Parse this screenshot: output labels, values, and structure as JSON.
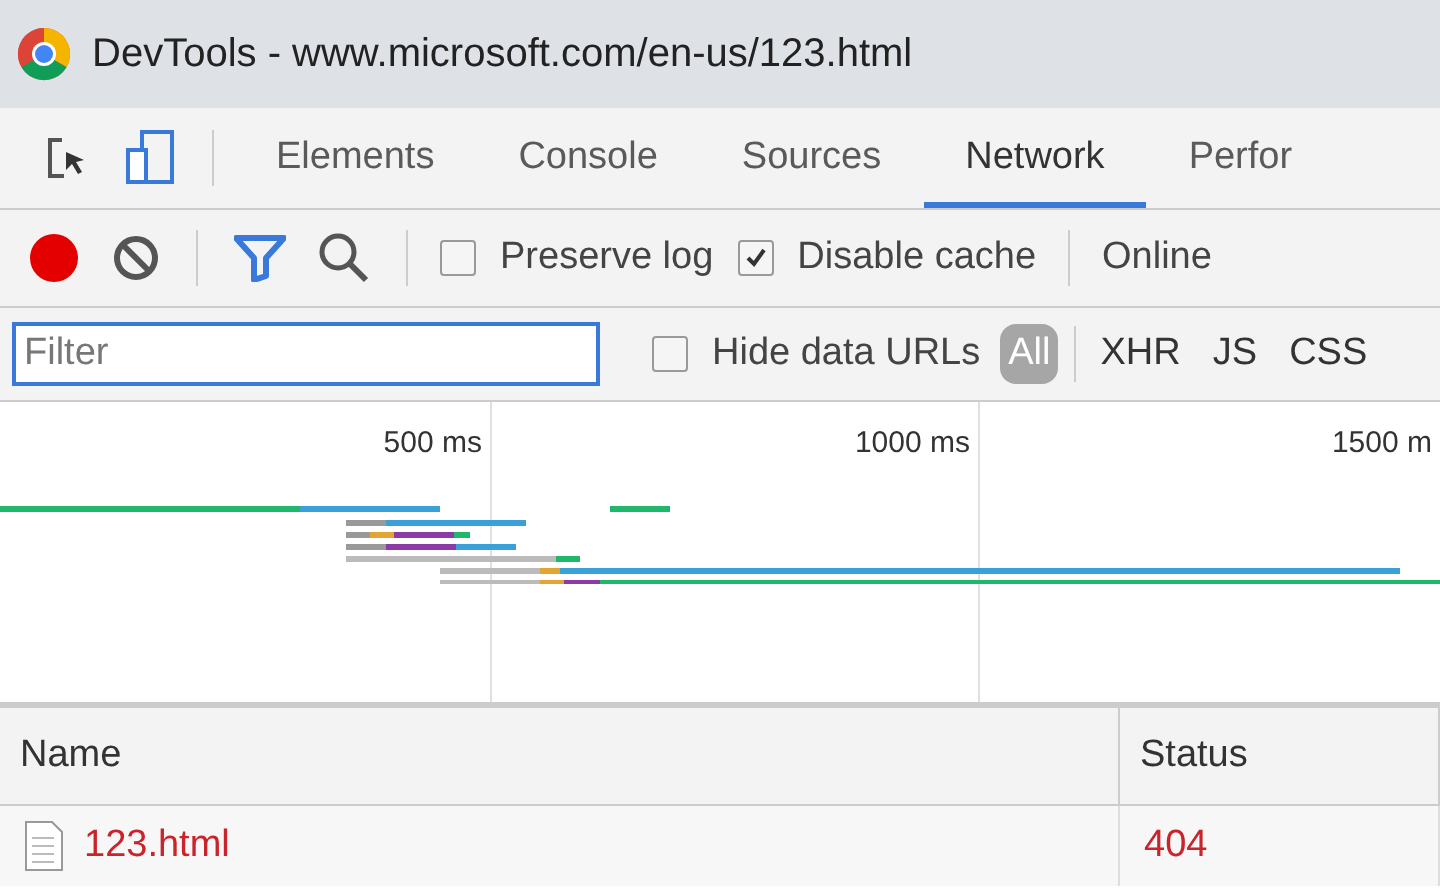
{
  "window": {
    "title": "DevTools - www.microsoft.com/en-us/123.html"
  },
  "tabs": [
    {
      "label": "Elements",
      "selected": false
    },
    {
      "label": "Console",
      "selected": false
    },
    {
      "label": "Sources",
      "selected": false
    },
    {
      "label": "Network",
      "selected": true
    },
    {
      "label": "Perfor",
      "selected": false
    }
  ],
  "toolbar": {
    "recording": true,
    "preserve_log": {
      "label": "Preserve log",
      "checked": false
    },
    "disable_cache": {
      "label": "Disable cache",
      "checked": true
    },
    "throttling": "Online"
  },
  "filter_bar": {
    "placeholder": "Filter",
    "hide_data_urls": {
      "label": "Hide data URLs",
      "checked": false
    },
    "types": [
      {
        "label": "All",
        "selected": true
      },
      {
        "label": "XHR",
        "selected": false
      },
      {
        "label": "JS",
        "selected": false
      },
      {
        "label": "CSS",
        "selected": false
      }
    ]
  },
  "overview": {
    "ticks": [
      "500 ms",
      "1000 ms",
      "1500 m"
    ]
  },
  "table": {
    "columns": [
      "Name",
      "Status"
    ],
    "rows": [
      {
        "name": "123.html",
        "status": "404",
        "error": true
      }
    ]
  }
}
